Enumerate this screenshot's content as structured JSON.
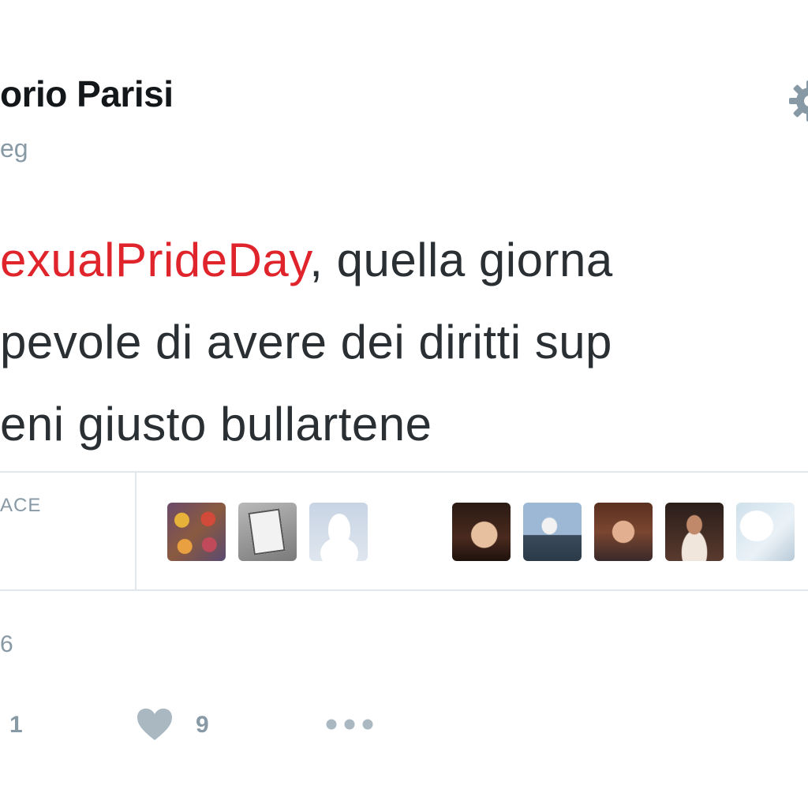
{
  "tweet": {
    "author_name": "orio Parisi",
    "author_handle": "eg",
    "text_lines": [
      {
        "hashtag": "exualPrideDay",
        "rest": ", quella giorna"
      },
      {
        "hashtag": "",
        "rest": "pevole di avere dei diritti sup"
      },
      {
        "hashtag": "",
        "rest": "eni giusto bullartene"
      }
    ],
    "hashtag_color": "#e0242b"
  },
  "stats": {
    "likes_label": "ACE",
    "avatar_count_shown": 8
  },
  "meta": {
    "date": "6"
  },
  "actions": {
    "retweet_count": "1",
    "like_count": "9",
    "like_icon": "heart-icon",
    "more_icon": "more-dots-icon"
  },
  "header": {
    "settings_icon": "gear-icon"
  }
}
